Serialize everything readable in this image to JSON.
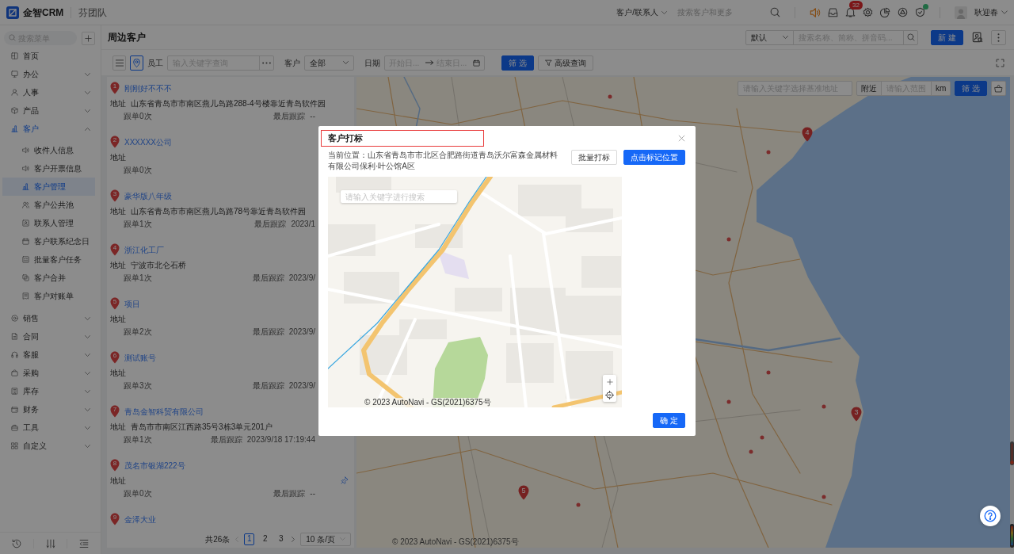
{
  "topbar": {
    "brand": "金智CRM",
    "team": "芬团队",
    "search_scope": "客户/联系人",
    "search_placeholder": "搜索客户和更多",
    "notification_count": "32",
    "user_name": "耿迎春"
  },
  "sidebar": {
    "search_placeholder": "搜索菜单",
    "items": [
      {
        "label": "首页",
        "kind": "link",
        "selected": false
      },
      {
        "label": "办公",
        "kind": "group",
        "expanded": false,
        "selected": false
      },
      {
        "label": "人事",
        "kind": "group",
        "expanded": false,
        "selected": false
      },
      {
        "label": "产品",
        "kind": "group",
        "expanded": false,
        "selected": false
      },
      {
        "label": "客户",
        "kind": "group",
        "expanded": true,
        "selected": false,
        "children": [
          {
            "label": "收件人信息",
            "selected": false
          },
          {
            "label": "客户开票信息",
            "selected": false
          },
          {
            "label": "客户管理",
            "selected": true
          },
          {
            "label": "客户公共池",
            "selected": false
          },
          {
            "label": "联系人管理",
            "selected": false
          },
          {
            "label": "客户联系纪念日",
            "selected": false
          },
          {
            "label": "批量客户任务",
            "selected": false
          },
          {
            "label": "客户合并",
            "selected": false
          },
          {
            "label": "客户对账单",
            "selected": false
          }
        ]
      },
      {
        "label": "销售",
        "kind": "group",
        "expanded": false,
        "selected": false
      },
      {
        "label": "合同",
        "kind": "group",
        "expanded": false,
        "selected": false
      },
      {
        "label": "客服",
        "kind": "group",
        "expanded": false,
        "selected": false
      },
      {
        "label": "采购",
        "kind": "group",
        "expanded": false,
        "selected": false
      },
      {
        "label": "库存",
        "kind": "group",
        "expanded": false,
        "selected": false
      },
      {
        "label": "财务",
        "kind": "group",
        "expanded": false,
        "selected": false
      },
      {
        "label": "工具",
        "kind": "group",
        "expanded": false,
        "selected": false
      },
      {
        "label": "自定义",
        "kind": "group",
        "expanded": false,
        "selected": false
      }
    ]
  },
  "page": {
    "title": "周边客户",
    "view_select": "默认",
    "search_placeholder": "搜索名称、简称、拼音码...",
    "new_button": "新 建"
  },
  "filters": {
    "view_toggle": [
      {
        "selected": false
      },
      {
        "selected": true
      }
    ],
    "employee_label": "员工",
    "employee_placeholder": "输入关键字查询",
    "customer_label": "客户",
    "customer_value": "全部",
    "date_label": "日期",
    "date_start_placeholder": "开始日...",
    "date_end_placeholder": "结束日...",
    "filter_button": "筛 选",
    "advanced_button": "高级查询"
  },
  "customers": [
    {
      "number": "1",
      "name": "刚刚好不不不",
      "address_label": "地址",
      "address": "山东省青岛市市南区燕儿岛路288-4号楼靠近青岛软件园",
      "pinned": false,
      "follow_count": "跟单0次",
      "last_follow_label": "最后跟踪",
      "last_follow": "--"
    },
    {
      "number": "2",
      "name": "XXXXXX公司",
      "address_label": "地址",
      "pinned": false,
      "follow_count": "跟单0次"
    },
    {
      "number": "3",
      "name": "豪华版八年级",
      "address_label": "地址",
      "address": "山东省青岛市市南区燕儿岛路78号靠近青岛软件园",
      "pinned": false,
      "follow_count": "跟单1次",
      "last_follow_label": "最后跟踪",
      "last_follow": "2023/1"
    },
    {
      "number": "4",
      "name": "浙江化工厂",
      "address_label": "地址",
      "address": "宁波市北仑石桥",
      "pinned": false,
      "follow_count": "跟单1次",
      "last_follow_label": "最后跟踪",
      "last_follow": "2023/9/"
    },
    {
      "number": "5",
      "name": "项目",
      "address_label": "地址",
      "pinned": false,
      "follow_count": "跟单2次",
      "last_follow_label": "最后跟踪",
      "last_follow": "2023/9/"
    },
    {
      "number": "6",
      "name": "测试账号",
      "address_label": "地址",
      "pinned": false,
      "follow_count": "跟单3次",
      "last_follow_label": "最后跟踪",
      "last_follow": "2023/9/"
    },
    {
      "number": "7",
      "name": "青岛金智科贸有限公司",
      "address_label": "地址",
      "address": "青岛市市南区江西路35号3栋3单元201户",
      "pinned": false,
      "follow_count": "跟单1次",
      "last_follow_label": "最后跟踪",
      "last_follow": "2023/9/18 17:19:44"
    },
    {
      "number": "8",
      "name": "茂名市银湖222号",
      "address_label": "地址",
      "pinned": true,
      "follow_count": "跟单0次",
      "last_follow_label": "最后跟踪",
      "last_follow": "--"
    },
    {
      "number": "9",
      "name": "金泽大业"
    }
  ],
  "pagination": {
    "total": "共26条",
    "pages": [
      {
        "label": "1",
        "selected": true
      },
      {
        "label": "2",
        "selected": false
      },
      {
        "label": "3",
        "selected": false
      }
    ],
    "page_size": "10 条/页"
  },
  "map": {
    "search_placeholder": "请输入关键字选择基准地址",
    "nearby_label": "附近",
    "range_placeholder": "请输入范围",
    "unit": "km",
    "filter_button": "筛 选",
    "markers": [
      {
        "number": "4"
      },
      {
        "number": "3"
      },
      {
        "number": "5"
      }
    ],
    "copyright": "© 2023 AutoNavi - GS(2021)6375号"
  },
  "dialog": {
    "title": "客户打标",
    "title_highlighted": true,
    "location": "当前位置：山东省青岛市市北区合肥路街道青岛沃尔富森金属材料有限公司保利·叶公馆A区",
    "batch_button": "批量打标",
    "mark_button": "点击标记位置",
    "map_search_placeholder": "请输入关键字进行搜索",
    "map_copyright": "© 2023 AutoNavi - GS(2021)6375号",
    "confirm_button": "确 定"
  }
}
